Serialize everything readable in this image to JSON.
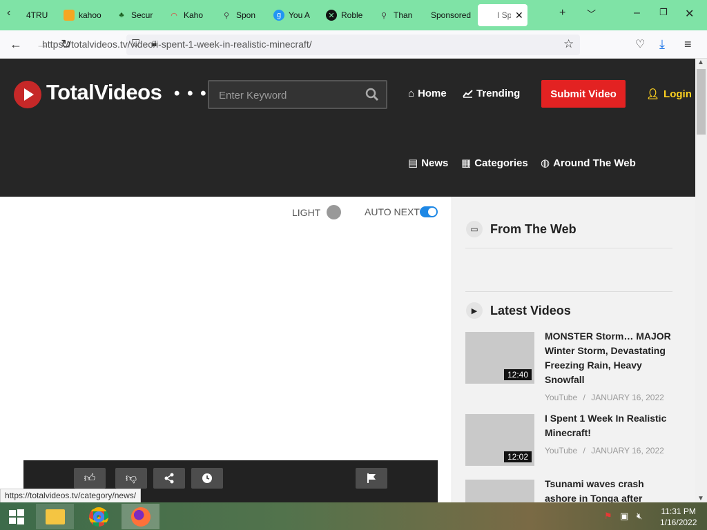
{
  "browser": {
    "tabs": [
      {
        "label": "4TRU",
        "icon": "page-icon"
      },
      {
        "label": "kahoo",
        "icon": "kahoot-icon"
      },
      {
        "label": "Secur",
        "icon": "security-icon"
      },
      {
        "label": "Kaho",
        "icon": "kahoot-rainbow-icon"
      },
      {
        "label": "Spon",
        "icon": "search-icon"
      },
      {
        "label": "You A",
        "icon": "g-icon"
      },
      {
        "label": "Roble",
        "icon": "xbox-icon"
      },
      {
        "label": "Than",
        "icon": "search-icon"
      },
      {
        "label": "Sponsored",
        "icon": ""
      },
      {
        "label": "I Sp",
        "icon": "",
        "active": true
      }
    ],
    "url": "https://totalvideos.tv/video/i-spent-1-week-in-realistic-minecraft/",
    "status_link": "https://totalvideos.tv/category/news/"
  },
  "site": {
    "logo_text": "TotalVideos",
    "search_placeholder": "Enter Keyword",
    "nav": {
      "home": "Home",
      "trending": "Trending",
      "submit": "Submit Video",
      "login": "Login",
      "news": "News",
      "categories": "Categories",
      "around": "Around The Web"
    },
    "colors": {
      "accent": "#e32222",
      "login": "#ffd21f",
      "header_bg": "#262626"
    }
  },
  "player": {
    "light_label": "LIGHT",
    "autonext_label": "AUTO NEXT"
  },
  "sidebar": {
    "from_web": "From The Web",
    "latest": "Latest Videos",
    "videos": [
      {
        "title": "MONSTER Storm… MAJOR Winter Storm, Devastating Freezing Rain, Heavy Snowfall",
        "duration": "12:40",
        "source": "YouTube",
        "date": "JANUARY 16, 2022"
      },
      {
        "title": "I Spent 1 Week In Realistic Minecraft!",
        "duration": "12:02",
        "source": "YouTube",
        "date": "JANUARY 16, 2022"
      },
      {
        "title": "Tsunami waves crash ashore in Tonga after",
        "duration": "",
        "source": "",
        "date": ""
      }
    ],
    "meta_sep": "/"
  },
  "taskbar": {
    "time": "11:31 PM",
    "date": "1/16/2022"
  }
}
